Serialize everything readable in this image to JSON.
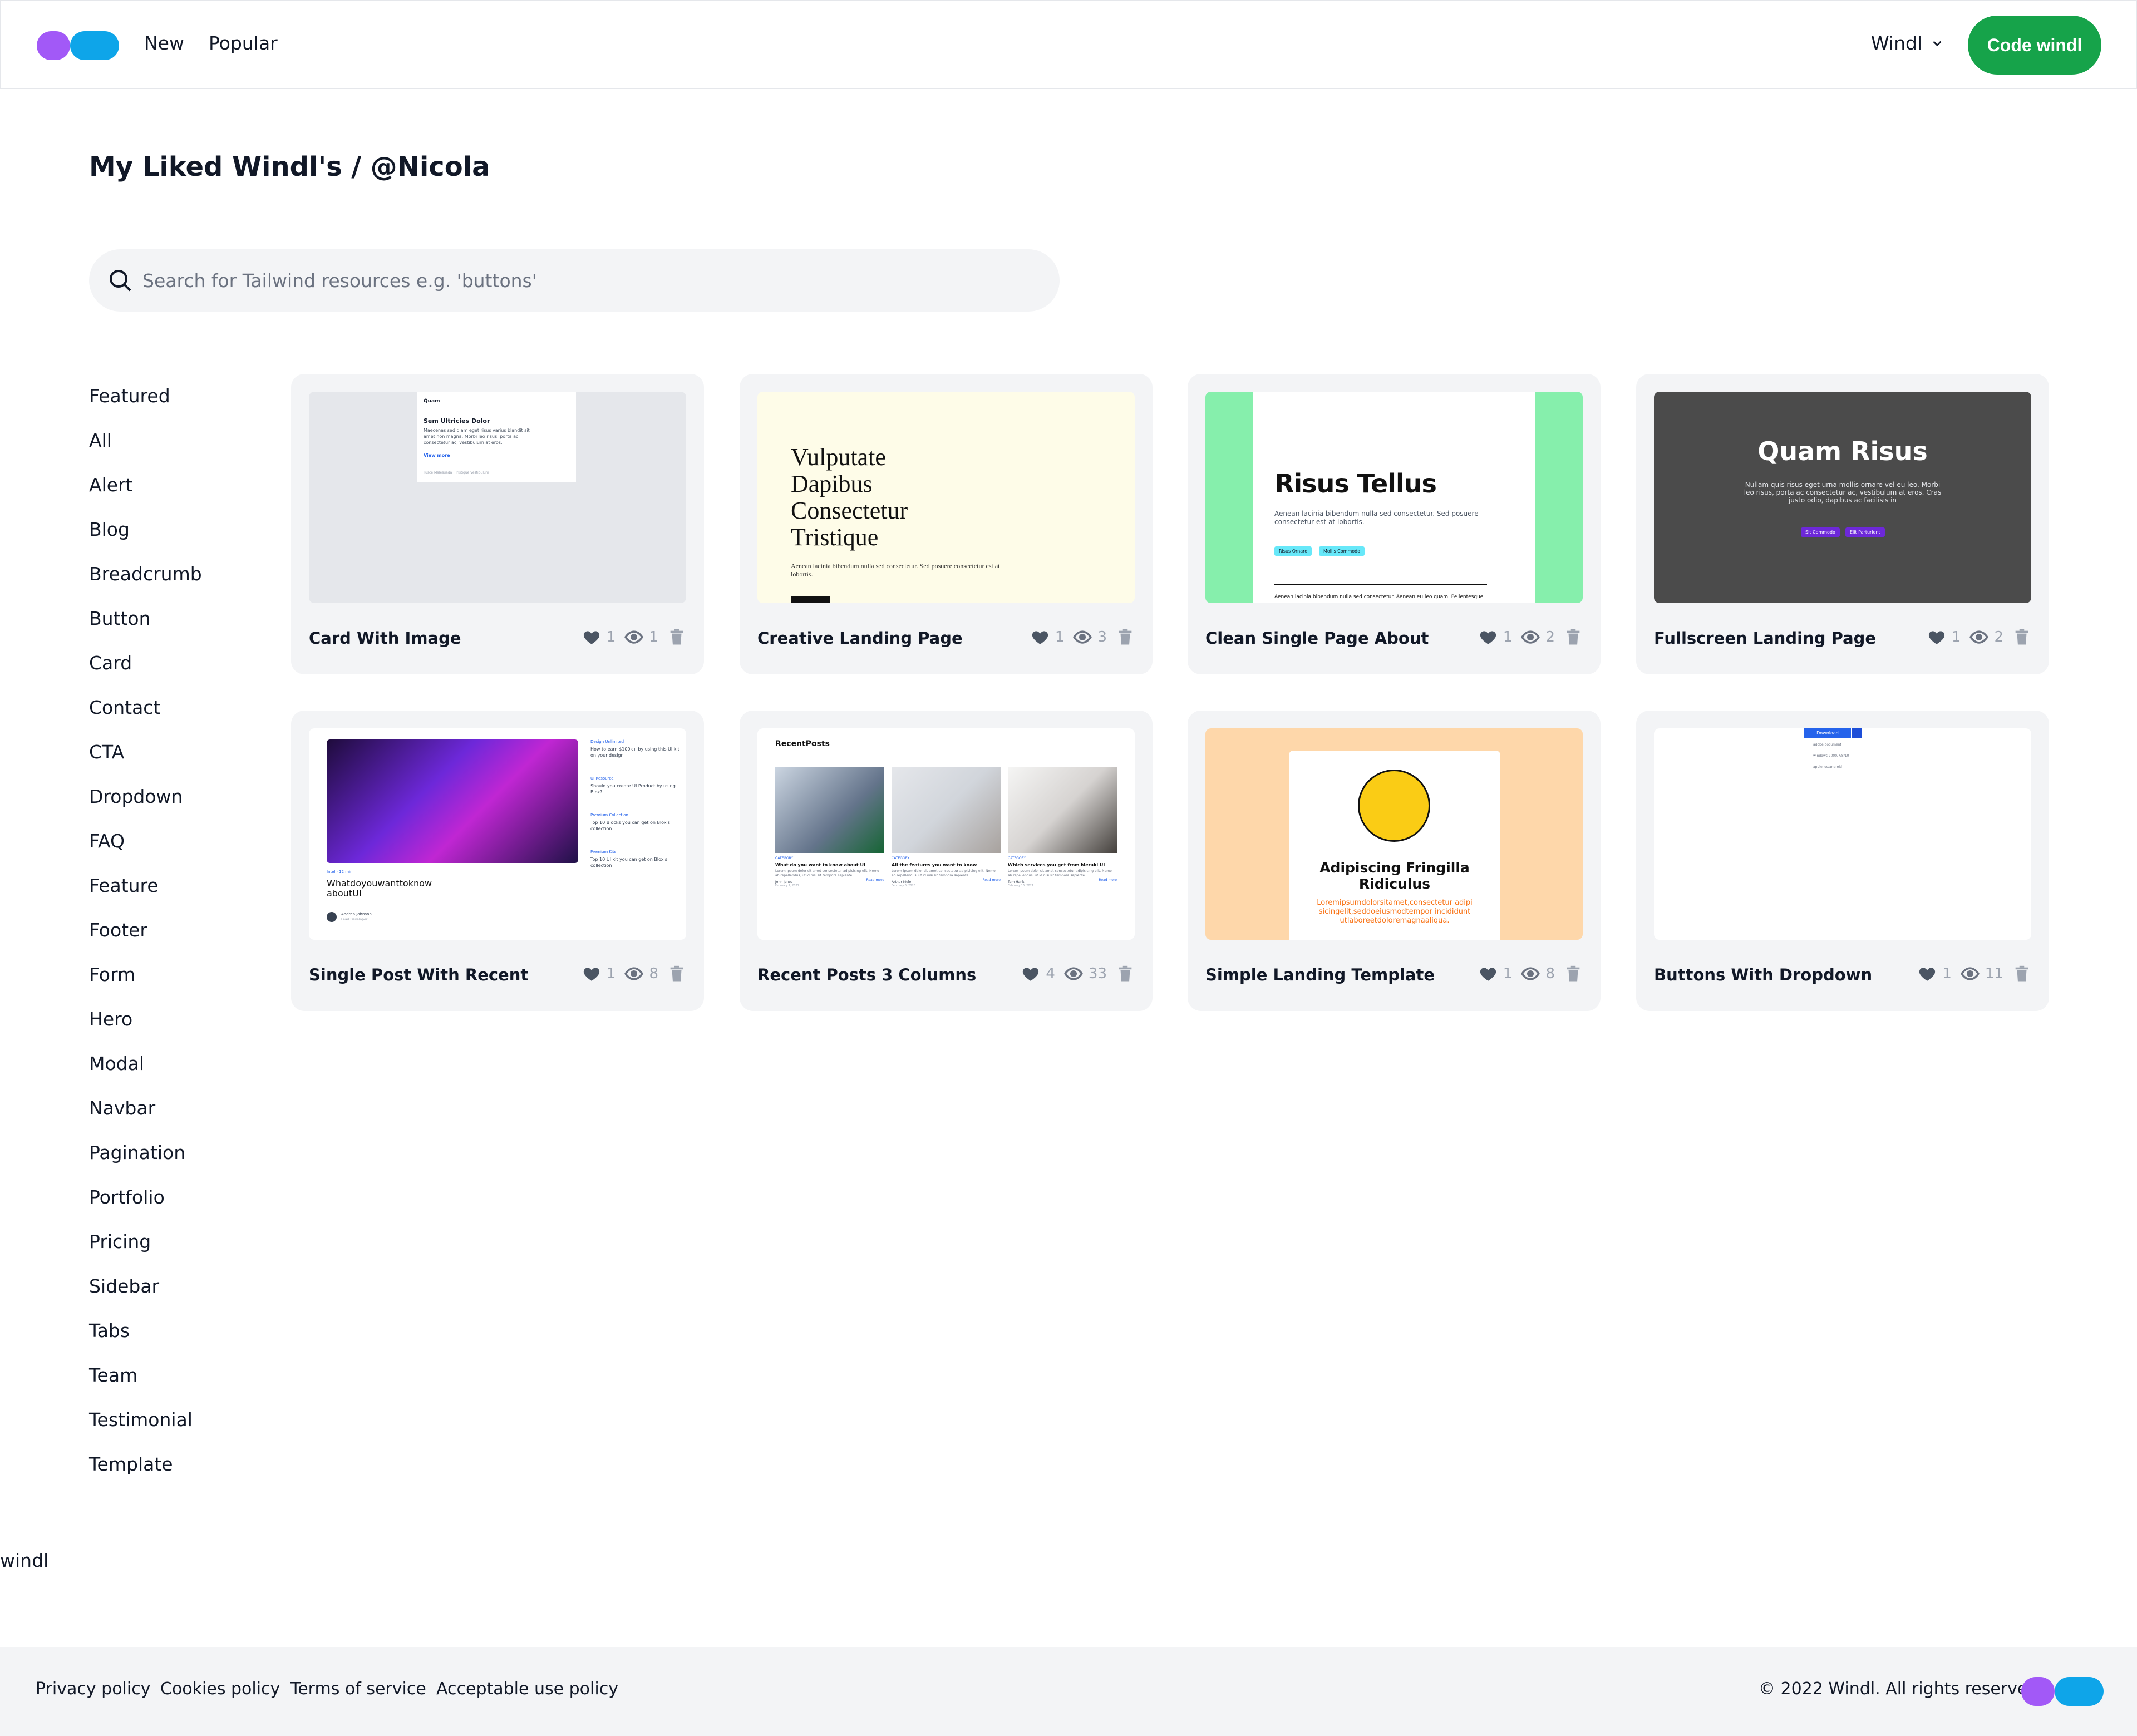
{
  "nav": {
    "links": [
      "New",
      "Popular"
    ],
    "dropdown_label": "Windl",
    "cta_label": "Code windl"
  },
  "page": {
    "title": "My Liked Windl's / @Nicola",
    "search_placeholder": "Search for Tailwind resources e.g. 'buttons'"
  },
  "sidebar": {
    "items": [
      "Featured",
      "All",
      "Alert",
      "Blog",
      "Breadcrumb",
      "Button",
      "Card",
      "Contact",
      "CTA",
      "Dropdown",
      "FAQ",
      "Feature",
      "Footer",
      "Form",
      "Hero",
      "Modal",
      "Navbar",
      "Pagination",
      "Portfolio",
      "Pricing",
      "Sidebar",
      "Tabs",
      "Team",
      "Testimonial",
      "Template"
    ]
  },
  "cards": [
    {
      "title": "Card With Image",
      "likes": "1",
      "views": "1"
    },
    {
      "title": "Creative Landing Page",
      "likes": "1",
      "views": "3"
    },
    {
      "title": "Clean Single Page About",
      "likes": "1",
      "views": "2"
    },
    {
      "title": "Fullscreen Landing Page",
      "likes": "1",
      "views": "2"
    },
    {
      "title": "Single Post With Recent",
      "likes": "1",
      "views": "8"
    },
    {
      "title": "Recent Posts 3 Columns",
      "likes": "4",
      "views": "33"
    },
    {
      "title": "Simple Landing Template",
      "likes": "1",
      "views": "8"
    },
    {
      "title": "Buttons With Dropdown",
      "likes": "1",
      "views": "11"
    }
  ],
  "thumbs": {
    "card_with_image": {
      "brand": "Quam",
      "heading": "Sem Ultricies Dolor",
      "body": "Maecenas sed diam eget risus varius blandit sit amet non magna. Morbi leo risus, porta ac consectetur ac, vestibulum at eros.",
      "link": "View more",
      "footer": "Fusce Malesuada · Tristique Vestibulum"
    },
    "creative_landing": {
      "heading": [
        "Vulputate",
        "Dapibus",
        "Consectetur",
        "Tristique"
      ],
      "body": "Aenean lacinia bibendum nulla sed consectetur. Sed posuere consectetur est at lobortis."
    },
    "clean_about": {
      "heading": "Risus Tellus",
      "body": "Aenean lacinia bibendum nulla sed consectetur. Sed posuere consectetur est at lobortis.",
      "btn1": "Risus Ornare",
      "btn2": "Mollis Commodo",
      "footer_text": "Aenean lacinia bibendum nulla sed consectetur. Aenean eu leo quam. Pellentesque"
    },
    "fullscreen_landing": {
      "heading": "Quam Risus",
      "body": "Nullam quis risus eget urna mollis ornare vel eu leo. Morbi leo risus, porta ac consectetur ac, vestibulum at eros. Cras justo odio, dapibus ac facilisis in",
      "btn1": "Sit Commodo",
      "btn2": "Elit Parturient"
    },
    "single_post": {
      "category": "Intel · 12 min",
      "heading": "Whatdoyouwanttoknow aboutUI",
      "author": "Andrea Johnson",
      "author_role": "Lead Developer",
      "links": [
        {
          "tag": "Design Unlimited",
          "text": "How to earn $100k+ by using this UI kit on your design"
        },
        {
          "tag": "UI Resource",
          "text": "Should you create UI Product by using Blox?"
        },
        {
          "tag": "Premium Collection",
          "text": "Top 10 Blocks you can get on Blox's collection"
        },
        {
          "tag": "Premium Kits",
          "text": "Top 10 UI kit you can get on Blox's collection"
        }
      ]
    },
    "recent_posts": {
      "heading": "RecentPosts",
      "posts": [
        {
          "cat": "CATEGORY",
          "title": "What do you want to know about UI",
          "body": "Lorem ipsum dolor sit amet consectetur adipisicing elit. Nemo ab repellendus, ut id nisi sit tempora sapiente.",
          "author": "John Jones",
          "date": "February 1, 2021",
          "more": "Read more"
        },
        {
          "cat": "CATEGORY",
          "title": "All the features you want to know",
          "body": "Lorem ipsum dolor sit amet consectetur adipisicing elit. Nemo ab repellendus, ut id nisi sit tempora sapiente.",
          "author": "Arthur Melo",
          "date": "February 6, 2020",
          "more": "Read more"
        },
        {
          "cat": "CATEGORY",
          "title": "Which services you get from Meraki UI",
          "body": "Lorem ipsum dolor sit amet consectetur adipisicing elit. Nemo ab repellendus, ut id nisi sit tempora sapiente.",
          "author": "Tom Hank",
          "date": "February 16, 2021",
          "more": "Read more"
        }
      ]
    },
    "simple_landing": {
      "heading": "Adipiscing Fringilla Ridiculus",
      "body": "Loremipsumdolorsitamet,consectetur adipisicingelit,seddoeiusmodtempor incididuntutlaboreetdoloremagnaaliqua."
    },
    "buttons_dropdown": {
      "btn": "Download",
      "items": [
        "adobe document",
        "windows 2000/7/8/10",
        "apple ios/android"
      ]
    }
  },
  "footer": {
    "brand": "windl",
    "links": [
      "Privacy policy",
      "Cookies policy",
      "Terms of service",
      "Acceptable use policy"
    ],
    "copyright": "© 2022 Windl. All rights reserved."
  },
  "colors": {
    "brand_purple": "#a259f7",
    "brand_blue": "#0ea5e9",
    "cta_green": "#16a34a",
    "card_bg": "#f3f4f6",
    "icon_gray": "#9ca3af"
  }
}
